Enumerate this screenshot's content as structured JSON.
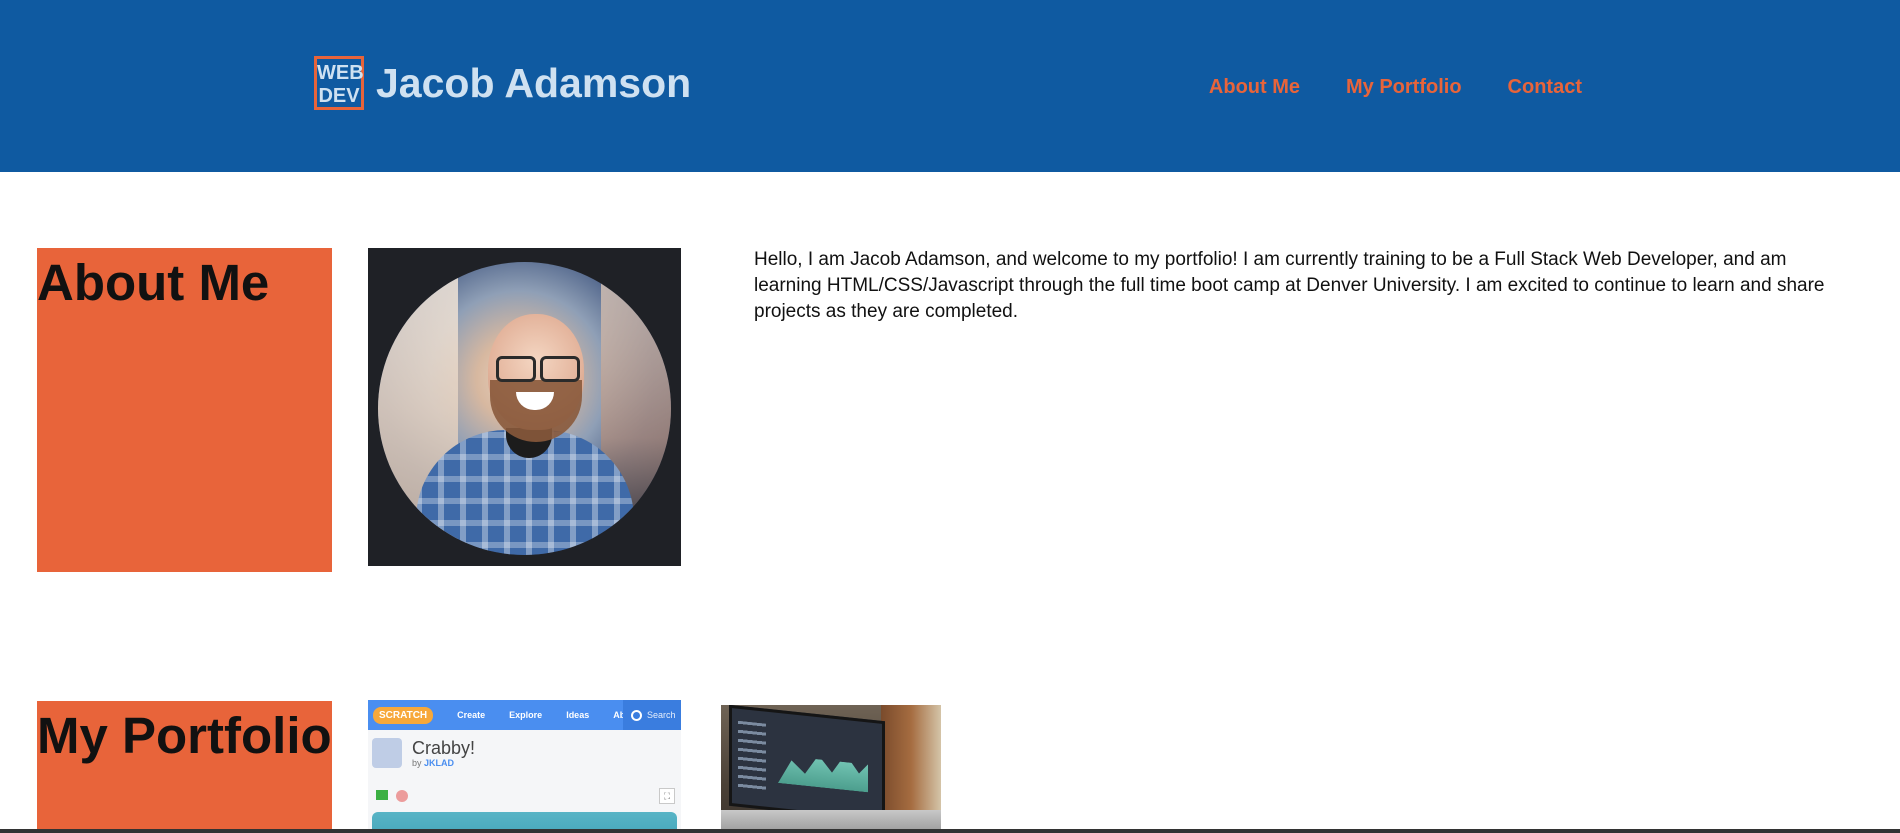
{
  "header": {
    "logo_line1": "WEB",
    "logo_line2": "DEV",
    "site_name": "Jacob Adamson",
    "nav": [
      {
        "label": "About Me"
      },
      {
        "label": "My Portfolio"
      },
      {
        "label": "Contact"
      }
    ]
  },
  "about": {
    "heading": "About Me",
    "text": "Hello, I am Jacob Adamson, and welcome to my portfolio! I am currently training to be a Full Stack Web Developer, and am learning HTML/CSS/Javascript through the full time boot camp at Denver University. I am excited to continue to learn and share projects as they are completed."
  },
  "portfolio": {
    "heading": "My Portfolio",
    "projects": [
      {
        "app_logo": "SCRATCH",
        "menu": [
          "Create",
          "Explore",
          "Ideas",
          "About"
        ],
        "search_placeholder": "Search",
        "title": "Crabby!",
        "by_prefix": "by",
        "author": "JKLAD"
      }
    ]
  },
  "colors": {
    "header_bg": "#0f5aa1",
    "accent": "#e8643a",
    "header_text": "#cfe1f1"
  }
}
